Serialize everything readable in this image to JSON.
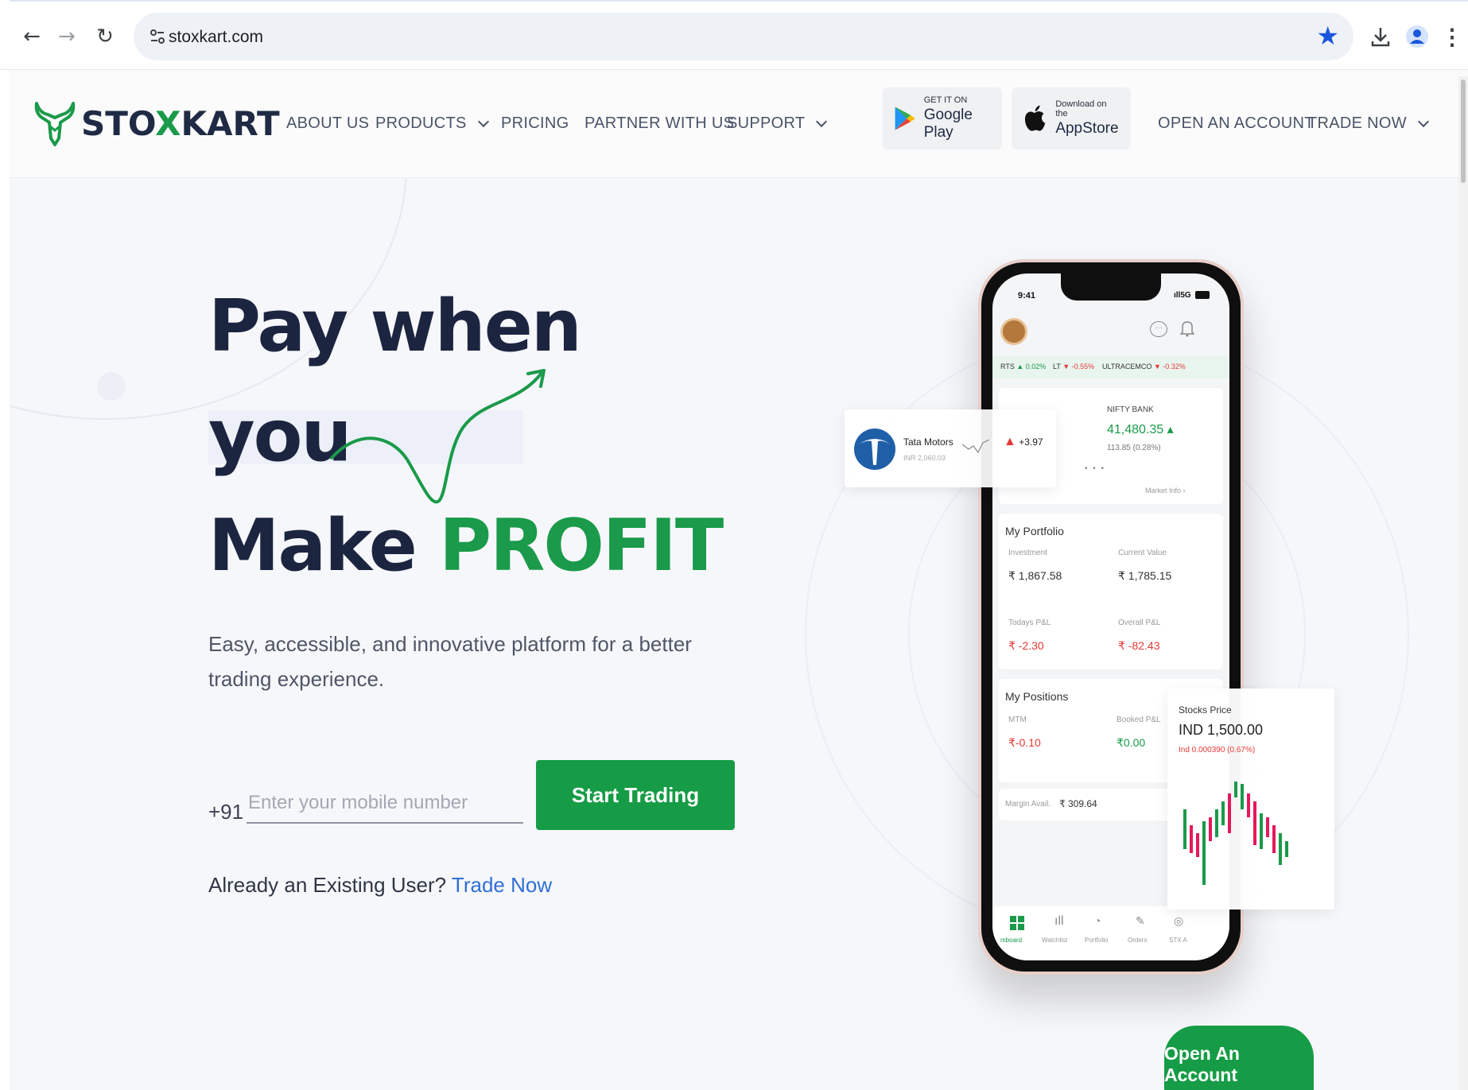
{
  "browser": {
    "url": "stoxkart.com",
    "accent": "#1a56db"
  },
  "site": {
    "brand": {
      "name_pre": "STO",
      "name_x": "X",
      "name_post": "KART",
      "color": "#1a9a4a"
    },
    "nav": {
      "about": "ABOUT US",
      "products": "PRODUCTS",
      "pricing": "PRICING",
      "partner": "PARTNER WITH US",
      "support": "SUPPORT",
      "open_account": "OPEN AN ACCOUNT",
      "trade_now": "TRADE NOW"
    },
    "stores": {
      "google_small": "GET IT ON",
      "google_big": "Google Play",
      "apple_small": "Download on the",
      "apple_big": "AppStore"
    }
  },
  "hero": {
    "line1": "Pay when",
    "line2": "you",
    "line3_a": "Make",
    "line3_b": "PROFIT",
    "subtitle": "Easy, accessible, and innovative platform for a better trading experience.",
    "country_code": "+91",
    "mobile_placeholder": "Enter your mobile number",
    "cta": "Start Trading",
    "existing_text": "Already an Existing User?",
    "existing_link": "Trade Now",
    "green": "#169c46"
  },
  "phone": {
    "time": "9:41",
    "signal": "5G",
    "ticker": [
      {
        "name": "RTS",
        "dir": "up",
        "change": "0.02%"
      },
      {
        "name": "LT",
        "dir": "down",
        "change": "-0.55%"
      },
      {
        "name": "ULTRACEMCO",
        "dir": "down",
        "change": "-0.32%"
      }
    ],
    "index_card": {
      "name": "NIFTY BANK",
      "value": "41,480.35",
      "change": "113.85 (0.28%)",
      "market_info": "Market Info"
    },
    "portfolio": {
      "title": "My Portfolio",
      "investment_label": "Investment",
      "investment_value": "₹ 1,867.58",
      "current_label": "Current Value",
      "current_value": "₹ 1,785.15",
      "todays_label": "Todays P&L",
      "todays_value": "₹ -2.30",
      "overall_label": "Overall P&L",
      "overall_value": "₹ -82.43"
    },
    "positions": {
      "title": "My Positions",
      "mtm_label": "MTM",
      "mtm_value": "₹-0.10",
      "booked_label": "Booked P&L",
      "booked_value": "₹0.00",
      "margin_label": "Margin Avail.",
      "margin_value": "₹ 309.64"
    },
    "tabs": [
      "mboard",
      "Watchlist",
      "Portfolio",
      "Orders",
      "STX A"
    ]
  },
  "tata_card": {
    "name": "Tata Motors",
    "sub": "INR 2,060.03",
    "change": "+3.97"
  },
  "stock_card": {
    "title": "Stocks Price",
    "value": "IND 1,500.00",
    "change": "Ind 0.000390 (0.67%)"
  },
  "open_account_btn": "Open An Account"
}
